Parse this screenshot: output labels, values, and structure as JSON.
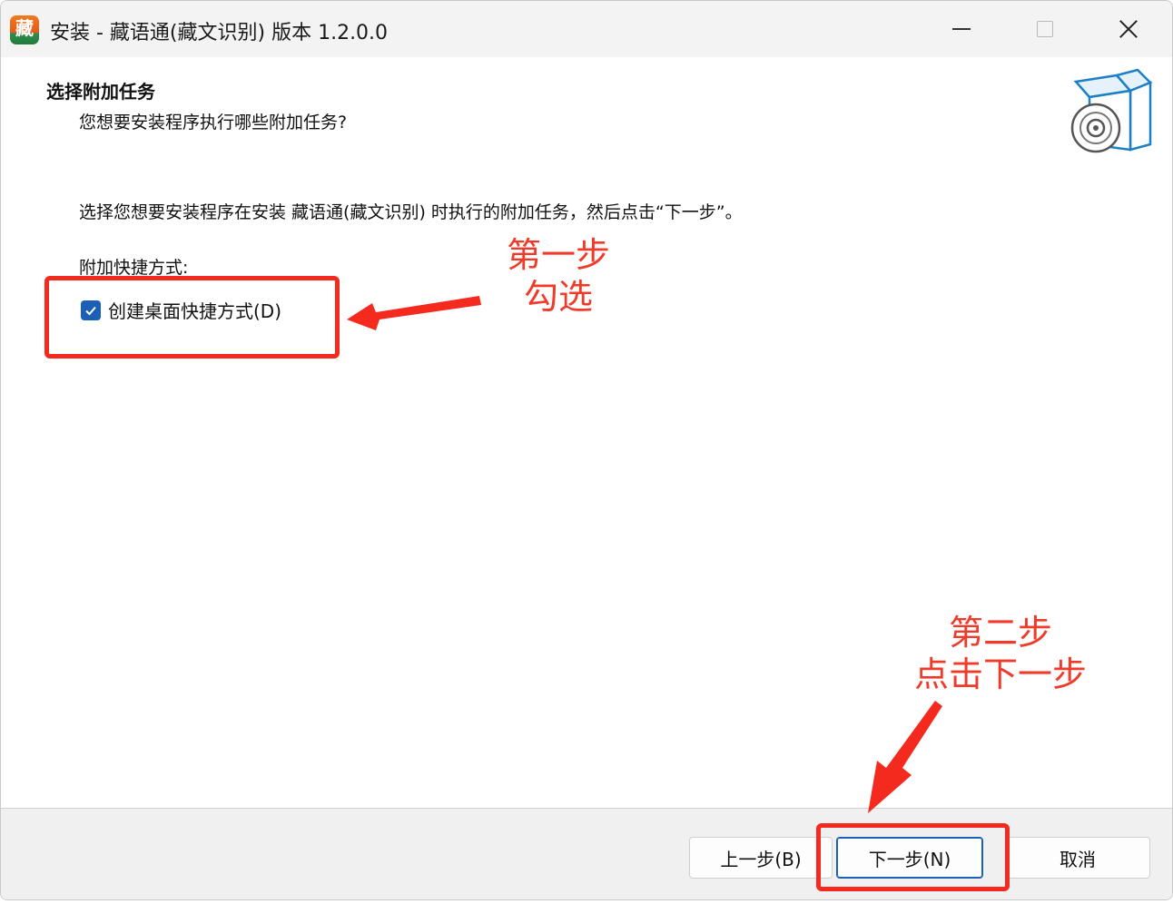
{
  "window": {
    "title": "安装 - 藏语通(藏文识别) 版本 1.2.0.0",
    "app_icon_glyph": "藏"
  },
  "page": {
    "heading": "选择附加任务",
    "subheading": "您想要安装程序执行哪些附加任务?",
    "description": "选择您想要安装程序在安装 藏语通(藏文识别) 时执行的附加任务，然后点击“下一步”。",
    "group_label": "附加快捷方式:",
    "checkbox": {
      "label": "创建桌面快捷方式(D)",
      "checked": true
    }
  },
  "buttons": {
    "back": "上一步(B)",
    "next": "下一步(N)",
    "cancel": "取消"
  },
  "annotations": {
    "step1_line1": "第一步",
    "step1_line2": "勾选",
    "step2_line1": "第二步",
    "step2_line2": "点击下一步",
    "color": "#f42a1e"
  },
  "colors": {
    "accent": "#1b5fb6"
  }
}
